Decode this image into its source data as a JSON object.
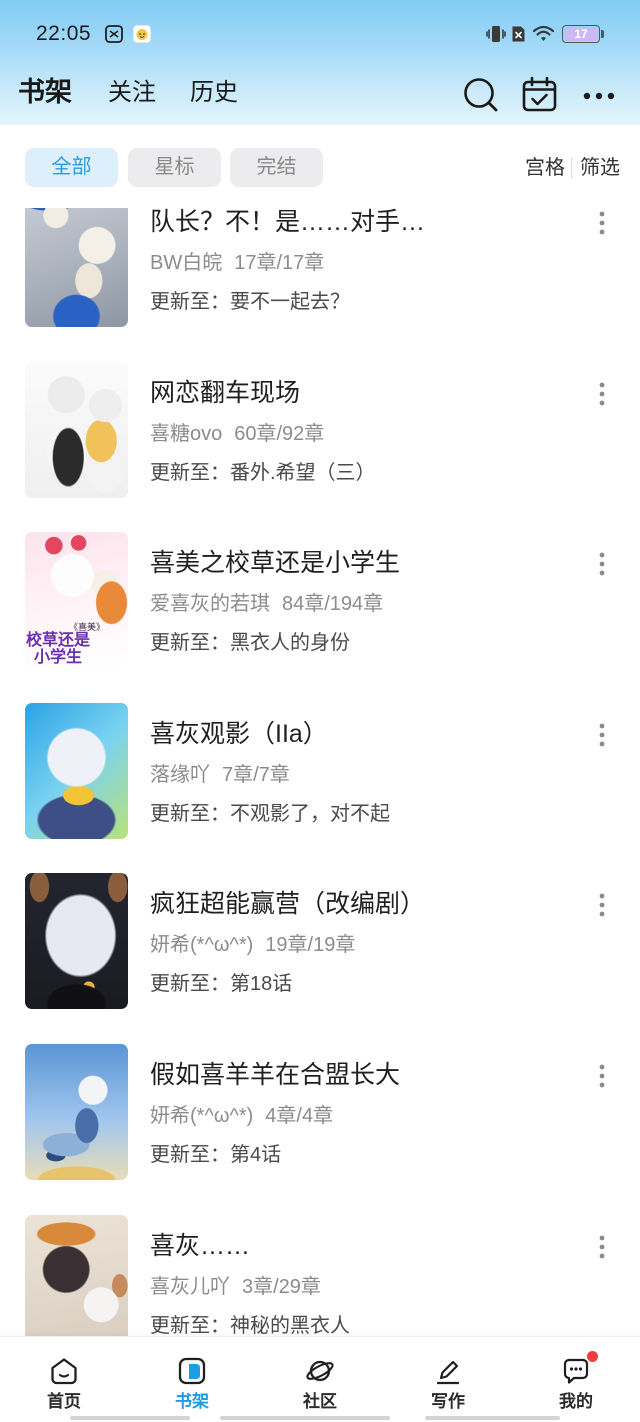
{
  "status_bar": {
    "time": "22:05",
    "battery_text": "17",
    "icons": [
      "notification-app-icon",
      "notification-emoji-icon",
      "vibrate-icon",
      "no-sim-icon",
      "wifi-icon",
      "battery-icon"
    ]
  },
  "header": {
    "tabs": [
      {
        "label": "书架",
        "active": true
      },
      {
        "label": "关注",
        "active": false
      },
      {
        "label": "历史",
        "active": false
      }
    ],
    "icons": [
      "search-icon",
      "calendar-check-icon",
      "more-horizontal-icon"
    ]
  },
  "filters": {
    "chips": [
      {
        "label": "全部",
        "active": true
      },
      {
        "label": "星标",
        "active": false
      },
      {
        "label": "完结",
        "active": false
      }
    ],
    "view_mode": "宫格",
    "filter": "筛选"
  },
  "labels": {
    "update_prefix": "更新至："
  },
  "books": [
    {
      "title": "队长？不！是……对手…",
      "author": "BW白皖",
      "chapters": "17章/17章",
      "latest": "要不一起去？"
    },
    {
      "title": "网恋翻车现场",
      "author": "喜糖ovo",
      "chapters": "60章/92章",
      "latest": "番外.希望（三）"
    },
    {
      "title": "喜美之校草还是小学生",
      "author": "爱喜灰的若琪",
      "chapters": "84章/194章",
      "latest": "黑衣人的身份",
      "cover_caption": "《喜美》",
      "cover_text": "校草还是小学生"
    },
    {
      "title": "喜灰观影（IIa）",
      "author": "落缘吖",
      "chapters": "7章/7章",
      "latest": "不观影了，对不起"
    },
    {
      "title": "疯狂超能赢营（改编剧）",
      "author": "妍希(*^ω^*)",
      "chapters": "19章/19章",
      "latest": "第18话"
    },
    {
      "title": "假如喜羊羊在合盟长大",
      "author": "妍希(*^ω^*)",
      "chapters": "4章/4章",
      "latest": "第4话"
    },
    {
      "title": "喜灰……",
      "author": "喜灰儿吖",
      "chapters": "3章/29章",
      "latest": "神秘的黑衣人"
    }
  ],
  "bottom_nav": {
    "items": [
      {
        "label": "首页",
        "icon": "home-icon",
        "active": false,
        "badge": false
      },
      {
        "label": "书架",
        "icon": "bookshelf-icon",
        "active": true,
        "badge": false
      },
      {
        "label": "社区",
        "icon": "planet-icon",
        "active": false,
        "badge": false
      },
      {
        "label": "写作",
        "icon": "pen-icon",
        "active": false,
        "badge": false
      },
      {
        "label": "我的",
        "icon": "message-icon",
        "active": false,
        "badge": true
      }
    ]
  },
  "colors": {
    "accent": "#1e9be6",
    "badge": "#f23b3b",
    "chip_active_bg": "#ddeffa"
  }
}
